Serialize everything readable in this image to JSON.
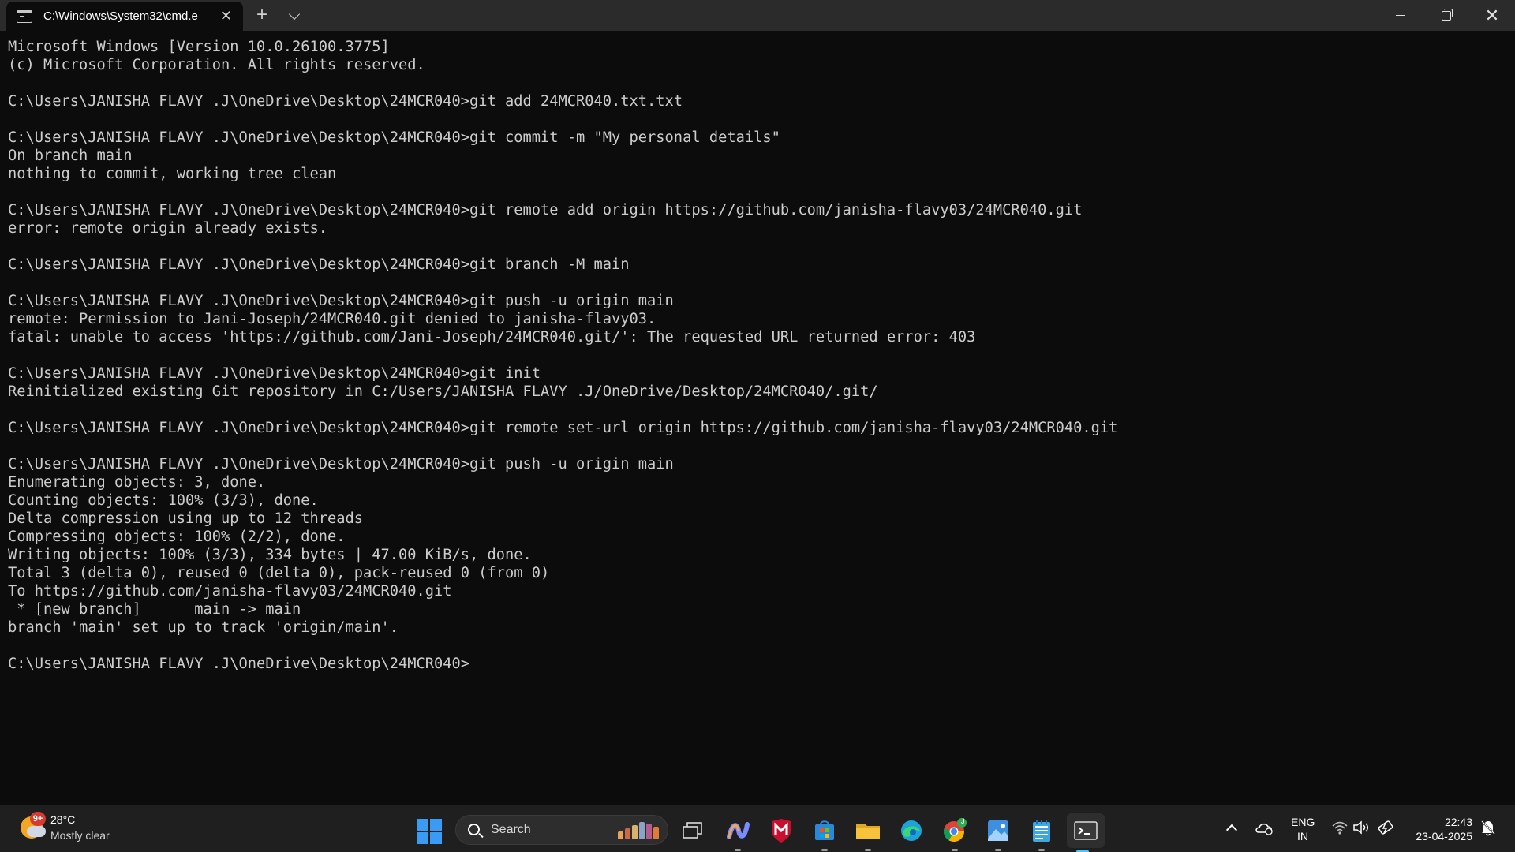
{
  "window": {
    "tab_title": "C:\\Windows\\System32\\cmd.e",
    "tab_close": "✕",
    "new_tab": "+",
    "close_symbol": "✕"
  },
  "terminal": {
    "lines": [
      "Microsoft Windows [Version 10.0.26100.3775]",
      "(c) Microsoft Corporation. All rights reserved.",
      "",
      "C:\\Users\\JANISHA FLAVY .J\\OneDrive\\Desktop\\24MCR040>git add 24MCR040.txt.txt",
      "",
      "C:\\Users\\JANISHA FLAVY .J\\OneDrive\\Desktop\\24MCR040>git commit -m \"My personal details\"",
      "On branch main",
      "nothing to commit, working tree clean",
      "",
      "C:\\Users\\JANISHA FLAVY .J\\OneDrive\\Desktop\\24MCR040>git remote add origin https://github.com/janisha-flavy03/24MCR040.git",
      "error: remote origin already exists.",
      "",
      "C:\\Users\\JANISHA FLAVY .J\\OneDrive\\Desktop\\24MCR040>git branch -M main",
      "",
      "C:\\Users\\JANISHA FLAVY .J\\OneDrive\\Desktop\\24MCR040>git push -u origin main",
      "remote: Permission to Jani-Joseph/24MCR040.git denied to janisha-flavy03.",
      "fatal: unable to access 'https://github.com/Jani-Joseph/24MCR040.git/': The requested URL returned error: 403",
      "",
      "C:\\Users\\JANISHA FLAVY .J\\OneDrive\\Desktop\\24MCR040>git init",
      "Reinitialized existing Git repository in C:/Users/JANISHA FLAVY .J/OneDrive/Desktop/24MCR040/.git/",
      "",
      "C:\\Users\\JANISHA FLAVY .J\\OneDrive\\Desktop\\24MCR040>git remote set-url origin https://github.com/janisha-flavy03/24MCR040.git",
      "",
      "C:\\Users\\JANISHA FLAVY .J\\OneDrive\\Desktop\\24MCR040>git push -u origin main",
      "Enumerating objects: 3, done.",
      "Counting objects: 100% (3/3), done.",
      "Delta compression using up to 12 threads",
      "Compressing objects: 100% (2/2), done.",
      "Writing objects: 100% (3/3), 334 bytes | 47.00 KiB/s, done.",
      "Total 3 (delta 0), reused 0 (delta 0), pack-reused 0 (from 0)",
      "To https://github.com/janisha-flavy03/24MCR040.git",
      " * [new branch]      main -> main",
      "branch 'main' set up to track 'origin/main'.",
      "",
      "C:\\Users\\JANISHA FLAVY .J\\OneDrive\\Desktop\\24MCR040>"
    ]
  },
  "taskbar": {
    "weather": {
      "badge": "9+",
      "temp": "28°C",
      "desc": "Mostly clear"
    },
    "search": {
      "label": "Search"
    },
    "apps": [
      {
        "name": "task-view-icon",
        "color": "#dcdcdc"
      },
      {
        "name": "copilot-icon",
        "color": "#7b8cff"
      },
      {
        "name": "mcafee-icon",
        "color": "#c8102e"
      },
      {
        "name": "microsoft-store-icon",
        "color": "#2b88d8"
      },
      {
        "name": "file-explorer-icon",
        "color": "#f7c33a"
      },
      {
        "name": "edge-icon",
        "color": "#1ea3d9"
      },
      {
        "name": "chrome-icon",
        "color": "#34a853",
        "badge": "J"
      },
      {
        "name": "photos-icon",
        "color": "#3d8fe0"
      },
      {
        "name": "notepad-icon",
        "color": "#3fa7e0"
      },
      {
        "name": "terminal-icon",
        "color": "#dcdcdc"
      }
    ],
    "lang": {
      "line1": "ENG",
      "line2": "IN"
    },
    "clock": {
      "time": "22:43",
      "date": "23-04-2025"
    }
  }
}
